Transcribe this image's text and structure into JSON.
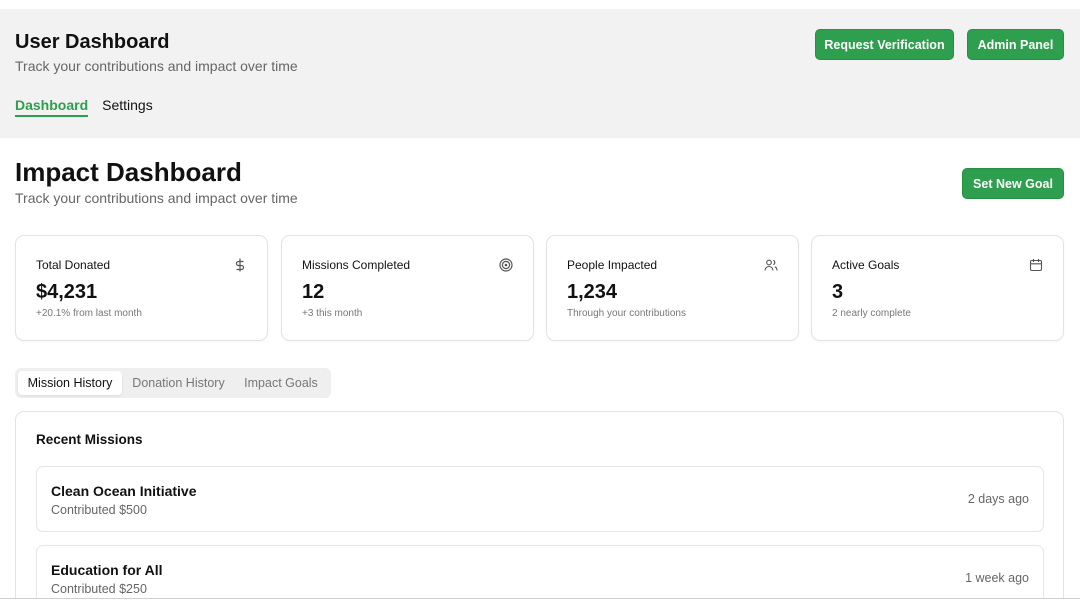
{
  "header": {
    "title": "User Dashboard",
    "subtitle": "Track your contributions and impact over time",
    "buttons": {
      "verify": "Request Verification",
      "admin": "Admin Panel"
    },
    "nav": [
      {
        "label": "Dashboard",
        "active": true
      },
      {
        "label": "Settings",
        "active": false
      }
    ]
  },
  "main": {
    "title": "Impact Dashboard",
    "subtitle": "Track your contributions and impact over time",
    "goal_button": "Set New Goal"
  },
  "stats": [
    {
      "label": "Total Donated",
      "value": "$4,231",
      "note": "+20.1% from last month",
      "icon": "dollar-icon"
    },
    {
      "label": "Missions Completed",
      "value": "12",
      "note": "+3 this month",
      "icon": "target-icon"
    },
    {
      "label": "People Impacted",
      "value": "1,234",
      "note": "Through your contributions",
      "icon": "users-icon"
    },
    {
      "label": "Active Goals",
      "value": "3",
      "note": "2 nearly complete",
      "icon": "calendar-icon"
    }
  ],
  "tabs": [
    {
      "label": "Mission History",
      "active": true
    },
    {
      "label": "Donation History",
      "active": false
    },
    {
      "label": "Impact Goals",
      "active": false
    }
  ],
  "recent": {
    "title": "Recent Missions",
    "items": [
      {
        "name": "Clean Ocean Initiative",
        "amount": "Contributed $500",
        "time": "2 days ago"
      },
      {
        "name": "Education for All",
        "amount": "Contributed $250",
        "time": "1 week ago"
      }
    ]
  },
  "colors": {
    "accent": "#2e9e4f",
    "header_bg": "#f2f2f2"
  }
}
